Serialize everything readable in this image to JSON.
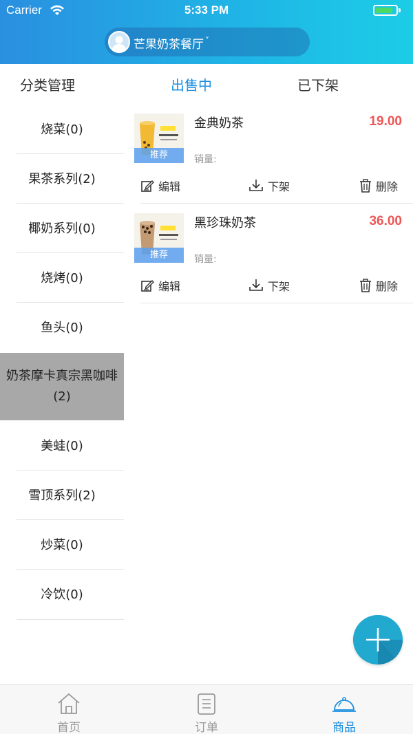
{
  "status_bar": {
    "carrier": "Carrier",
    "time": "5:33 PM",
    "battery_level": 0.85
  },
  "header": {
    "store_name": "芒果奶茶餐厅",
    "chevron": "˅"
  },
  "tabs": [
    {
      "label": "分类管理",
      "active": false
    },
    {
      "label": "出售中",
      "active": true
    },
    {
      "label": "已下架",
      "active": false
    }
  ],
  "categories": [
    {
      "label": "烧菜(0)"
    },
    {
      "label": "果茶系列(2)"
    },
    {
      "label": "椰奶系列(0)"
    },
    {
      "label": "烧烤(0)"
    },
    {
      "label": "鱼头(0)"
    },
    {
      "label": "奶茶摩卡真宗黑咖啡(2)",
      "active": true
    },
    {
      "label": "美蛙(0)"
    },
    {
      "label": "雪顶系列(2)"
    },
    {
      "label": "炒菜(0)"
    },
    {
      "label": "冷饮(0)"
    }
  ],
  "products": [
    {
      "name": "金典奶茶",
      "price": "19.00",
      "badge": "推荐",
      "sales_label": "销量:",
      "thumb_color": "#f2b933"
    },
    {
      "name": "黑珍珠奶茶",
      "price": "36.00",
      "badge": "推荐",
      "sales_label": "销量:",
      "thumb_color": "#b58a63"
    }
  ],
  "actions": {
    "edit": "编辑",
    "unlist": "下架",
    "delete": "删除"
  },
  "bottom_nav": [
    {
      "label": "首页",
      "icon": "home-icon",
      "active": false
    },
    {
      "label": "订单",
      "icon": "order-icon",
      "active": false
    },
    {
      "label": "商品",
      "icon": "goods-icon",
      "active": true
    }
  ],
  "colors": {
    "accent": "#1a8fe0",
    "price": "#ee5555",
    "active_category": "#a8a8a8",
    "fab": "#1b9ec2"
  }
}
